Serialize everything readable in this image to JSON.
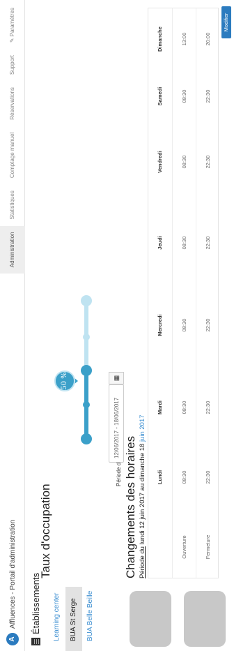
{
  "header": {
    "logo_glyph": "A",
    "app_title": "Affluences - Portail d'administration",
    "menu": [
      {
        "label": "Administration",
        "active": true
      },
      {
        "label": "Statistiques"
      },
      {
        "label": "Comptage manuel"
      },
      {
        "label": "Réservations"
      },
      {
        "label": "Support"
      },
      {
        "label": "Paramètres",
        "icon": "wrench-icon"
      }
    ]
  },
  "sidebar": {
    "title": "Établissements",
    "icon": "building-icon",
    "items": [
      {
        "label": "Learning center"
      },
      {
        "label": "BUA St Serge",
        "active": true
      },
      {
        "label": "BUA Belle Beille"
      }
    ]
  },
  "occupation": {
    "title": "Taux d'occupation",
    "value_label": "50 %",
    "value": 50,
    "colors": {
      "filled": "#3ba0c9",
      "empty": "#bfe3f1"
    }
  },
  "schedule": {
    "title": "Changements des horaires",
    "periode_label": "Période du",
    "date_range": "12/06/2017 - 18/06/2017",
    "period_prefix": "Période du",
    "period_rest": " lundi 12 juin 2017 au dimanche 18 ",
    "period_month": "juin 2017",
    "columns": [
      "",
      "Lundi",
      "Mardi",
      "Mercredi",
      "Jeudi",
      "Vendredi",
      "Samedi",
      "Dimanche"
    ],
    "rows": [
      {
        "label": "Ouverture",
        "values": [
          "08:30",
          "08:30",
          "08:30",
          "08:30",
          "08:30",
          "08:30",
          "13:00"
        ]
      },
      {
        "label": "Fermeture",
        "values": [
          "22:30",
          "22:30",
          "22:30",
          "22:30",
          "22:30",
          "22:30",
          "20:00"
        ]
      }
    ],
    "modify_label": "Modifier",
    "accent": "#2b7bbf"
  }
}
